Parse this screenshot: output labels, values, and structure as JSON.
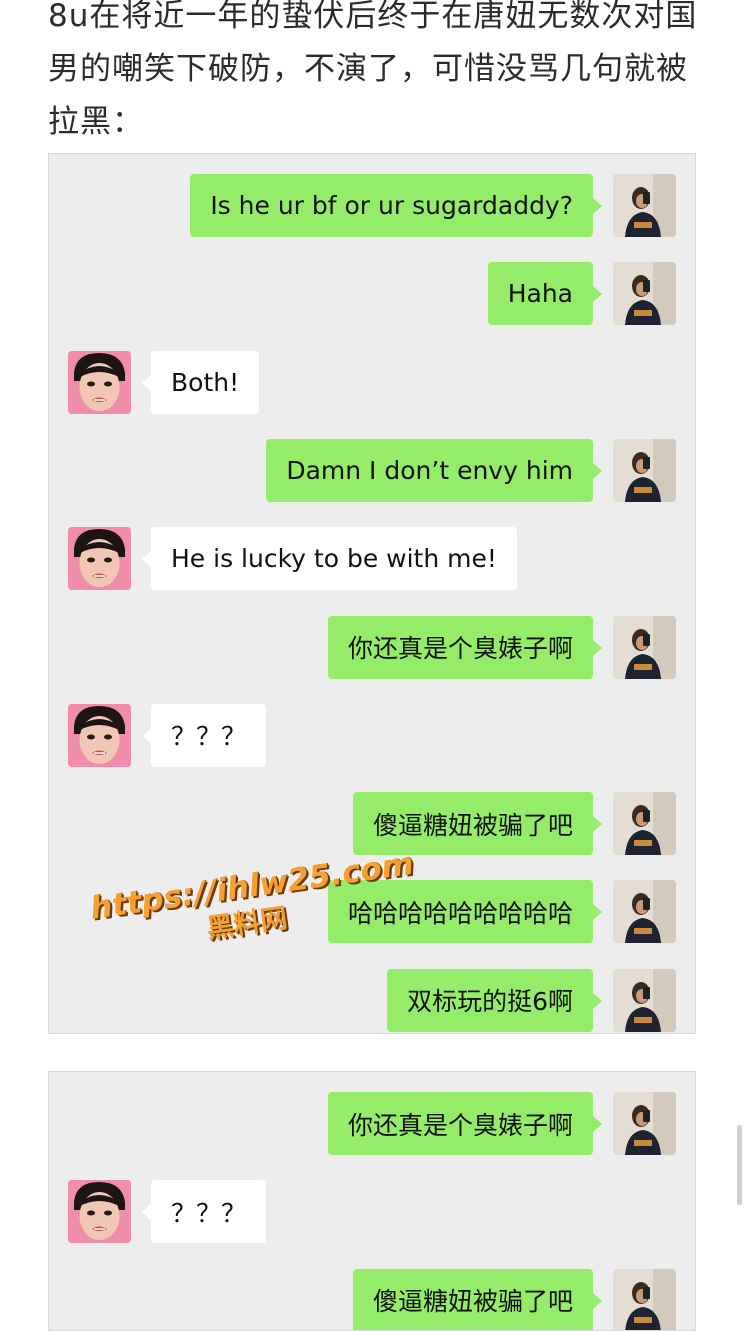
{
  "article": {
    "intro_text": "8u在将近一年的蛰伏后终于在唐妞无数次对国男的嘲笑下破防，不演了，可惜没骂几句就被拉黑："
  },
  "colors": {
    "sent_bubble": "#95ec69",
    "received_bubble": "#ffffff",
    "chat_background": "#ededed",
    "watermark": "#f7a032"
  },
  "screenshot_1": {
    "messages": [
      {
        "sender": "self",
        "text": "Is he ur bf or ur sugardaddy?"
      },
      {
        "sender": "self",
        "text": "Haha"
      },
      {
        "sender": "other",
        "text": "Both!"
      },
      {
        "sender": "self",
        "text": "Damn I don’t envy him"
      },
      {
        "sender": "other",
        "text": "He is lucky to be with me!"
      },
      {
        "sender": "self",
        "text": "你还真是个臭婊子啊"
      },
      {
        "sender": "other",
        "text": "？？？"
      },
      {
        "sender": "self",
        "text": "傻逼糖妞被骗了吧"
      },
      {
        "sender": "self",
        "text": "哈哈哈哈哈哈哈哈哈"
      },
      {
        "sender": "self",
        "text": "双标玩的挺6啊"
      }
    ]
  },
  "screenshot_2": {
    "messages": [
      {
        "sender": "self",
        "text": "你还真是个臭婊子啊"
      },
      {
        "sender": "other",
        "text": "？？？"
      },
      {
        "sender": "self",
        "text": "傻逼糖妞被骗了吧"
      }
    ]
  },
  "watermark": {
    "url": "https://ihlw25.com",
    "name": "黑料网"
  }
}
